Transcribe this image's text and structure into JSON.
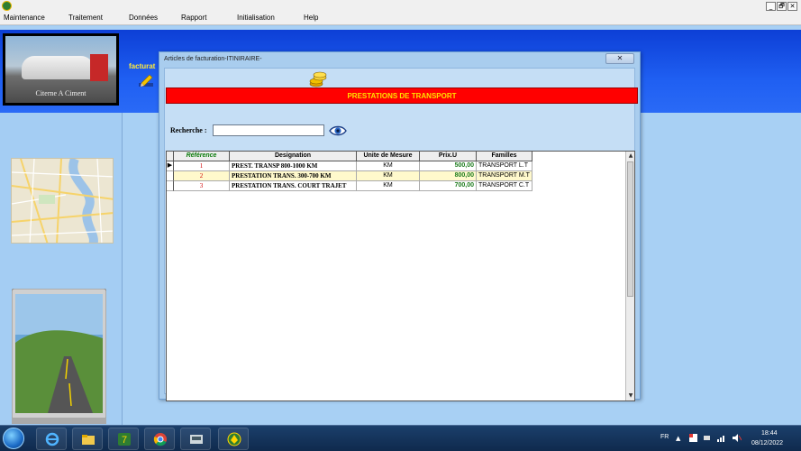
{
  "menubar": {
    "items": [
      "Maintenance",
      "Traitement",
      "Données",
      "Rapport",
      "Initialisation",
      "Help"
    ],
    "window_controls": [
      "_",
      "🗗",
      "✕"
    ]
  },
  "left": {
    "photo_caption": "Citerne A Ciment",
    "facturation_label": "facturat"
  },
  "dialog": {
    "title": "Articles de facturation-ITINIRAIRE-",
    "close": "✕",
    "header": "PRESTATIONS DE TRANSPORT",
    "search_label": "Recherche :",
    "search_value": "",
    "grid": {
      "columns": [
        "Référence",
        "Designation",
        "Unite de Mesure",
        "Prix.U",
        "Familles"
      ],
      "rows": [
        {
          "sel": "▶",
          "ref": "1",
          "designation": "PREST. TRANSP 800-1000 KM",
          "unite": "KM",
          "prix": "500,00",
          "famille": "TRANSPORT L.T"
        },
        {
          "sel": "",
          "ref": "2",
          "designation": "PRESTATION TRANS. 300-700 KM",
          "unite": "KM",
          "prix": "800,00",
          "famille": "TRANSPORT M.T"
        },
        {
          "sel": "",
          "ref": "3",
          "designation": "PRESTATION TRANS. COURT TRAJET",
          "unite": "KM",
          "prix": "700,00",
          "famille": "TRANSPORT C.T"
        }
      ]
    }
  },
  "taskbar": {
    "language": "FR",
    "time": "18:44",
    "date": "08/12/2022"
  }
}
